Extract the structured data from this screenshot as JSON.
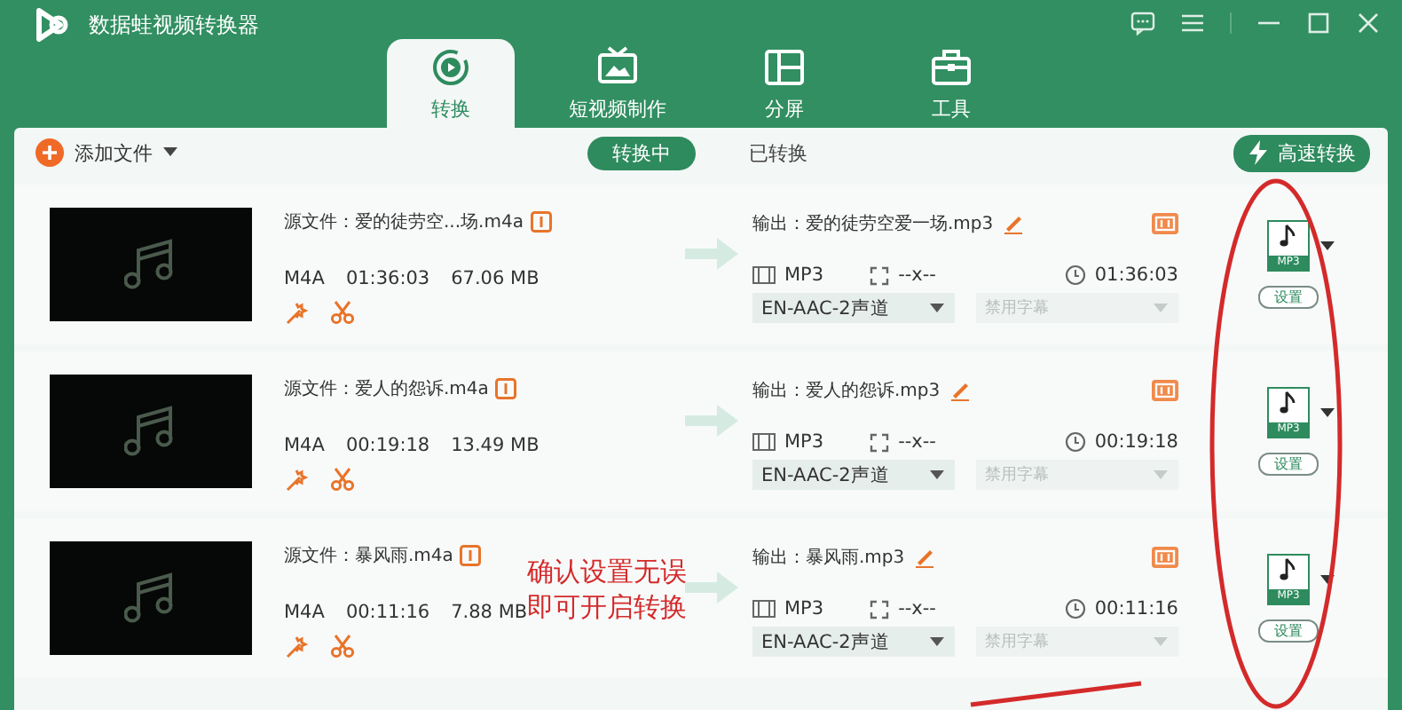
{
  "window": {
    "title": "数据蛙视频转换器"
  },
  "tabs": [
    {
      "label": "转换",
      "selected": true,
      "kind": "convert"
    },
    {
      "label": "短视频制作",
      "selected": false,
      "kind": "video"
    },
    {
      "label": "分屏",
      "selected": false,
      "kind": "split"
    },
    {
      "label": "工具",
      "selected": false,
      "kind": "tools"
    }
  ],
  "toolbar": {
    "add_file": "添加文件",
    "filters": [
      {
        "label": "转换中",
        "selected": true
      },
      {
        "label": "已转换",
        "selected": false
      }
    ],
    "turbo": "高速转换"
  },
  "files": [
    {
      "source": "源文件：爱的徒劳空...场.m4a",
      "format": "M4A",
      "duration": "01:36:03",
      "size": "67.06 MB",
      "output": "输出：爱的徒劳空爱一场.mp3",
      "output_format": "MP3",
      "resolution": "--x--",
      "output_duration": "01:36:03",
      "audio_track": "EN-AAC-2声道",
      "subtitle": "禁用字幕",
      "subtitle_disabled": true,
      "badge": "MP3",
      "settings": "设置"
    },
    {
      "source": "源文件：爱人的怨诉.m4a",
      "format": "M4A",
      "duration": "00:19:18",
      "size": "13.49 MB",
      "output": "输出：爱人的怨诉.mp3",
      "output_format": "MP3",
      "resolution": "--x--",
      "output_duration": "00:19:18",
      "audio_track": "EN-AAC-2声道",
      "subtitle": "禁用字幕",
      "subtitle_disabled": true,
      "badge": "MP3",
      "settings": "设置"
    },
    {
      "source": "源文件：暴风雨.m4a",
      "format": "M4A",
      "duration": "00:11:16",
      "size": "7.88 MB",
      "output": "输出：暴风雨.mp3",
      "output_format": "MP3",
      "resolution": "--x--",
      "output_duration": "00:11:16",
      "audio_track": "EN-AAC-2声道",
      "subtitle": "禁用字幕",
      "subtitle_disabled": true,
      "badge": "MP3",
      "settings": "设置"
    }
  ],
  "annotation": {
    "lines": [
      "确认设置无误",
      "即可开启转换"
    ]
  }
}
